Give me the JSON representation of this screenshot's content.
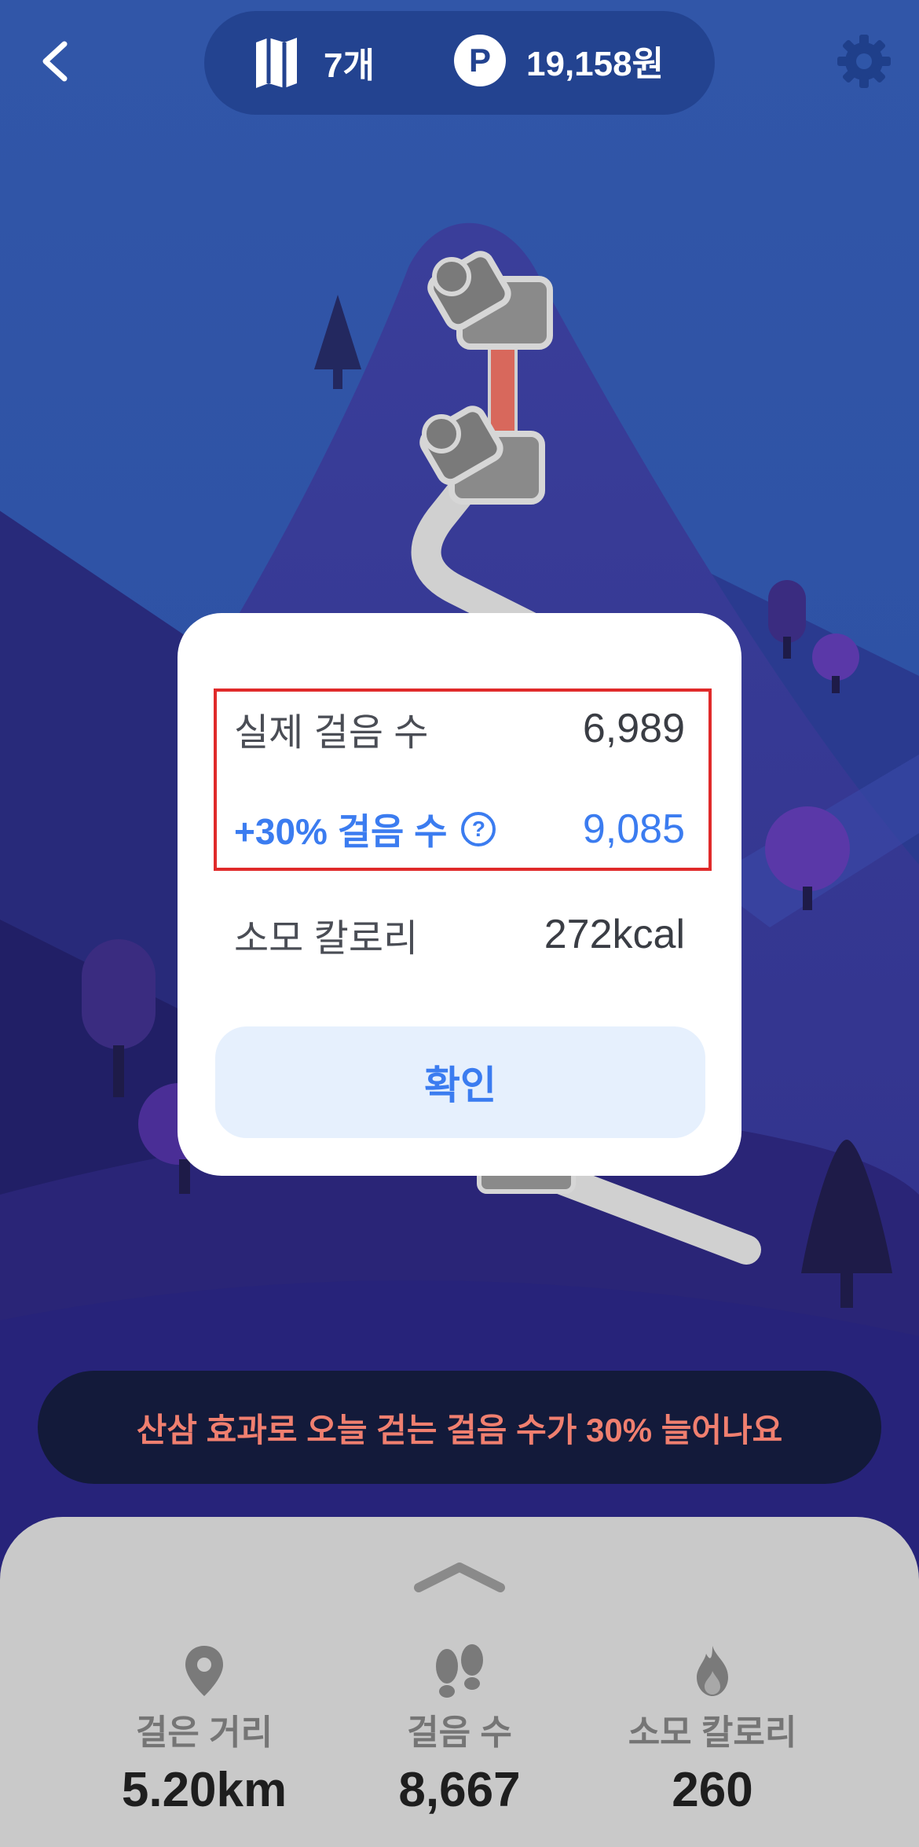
{
  "top": {
    "map_count": "7개",
    "points_icon_letter": "P",
    "points": "19,158원"
  },
  "modal": {
    "actual_steps_label": "실제 걸음 수",
    "actual_steps_value": "6,989",
    "bonus_steps_label": "+30% 걸음 수",
    "bonus_help_icon": "?",
    "bonus_steps_value": "9,085",
    "calories_label": "소모 칼로리",
    "calories_value": "272kcal",
    "confirm_label": "확인"
  },
  "banner": {
    "text": "산삼 효과로 오늘 걷는 걸음 수가 30% 늘어나요"
  },
  "stats": [
    {
      "label": "걸은 거리",
      "value": "5.20km",
      "icon": "location-pin-icon"
    },
    {
      "label": "걸음 수",
      "value": "8,667",
      "icon": "footprints-icon"
    },
    {
      "label": "소모 칼로리",
      "value": "260",
      "icon": "flame-icon"
    }
  ],
  "colors": {
    "accent_blue": "#3b7cf0",
    "highlight_red": "#e02a2a",
    "banner_text": "#f07f6f",
    "sky": "#2f56a8"
  }
}
